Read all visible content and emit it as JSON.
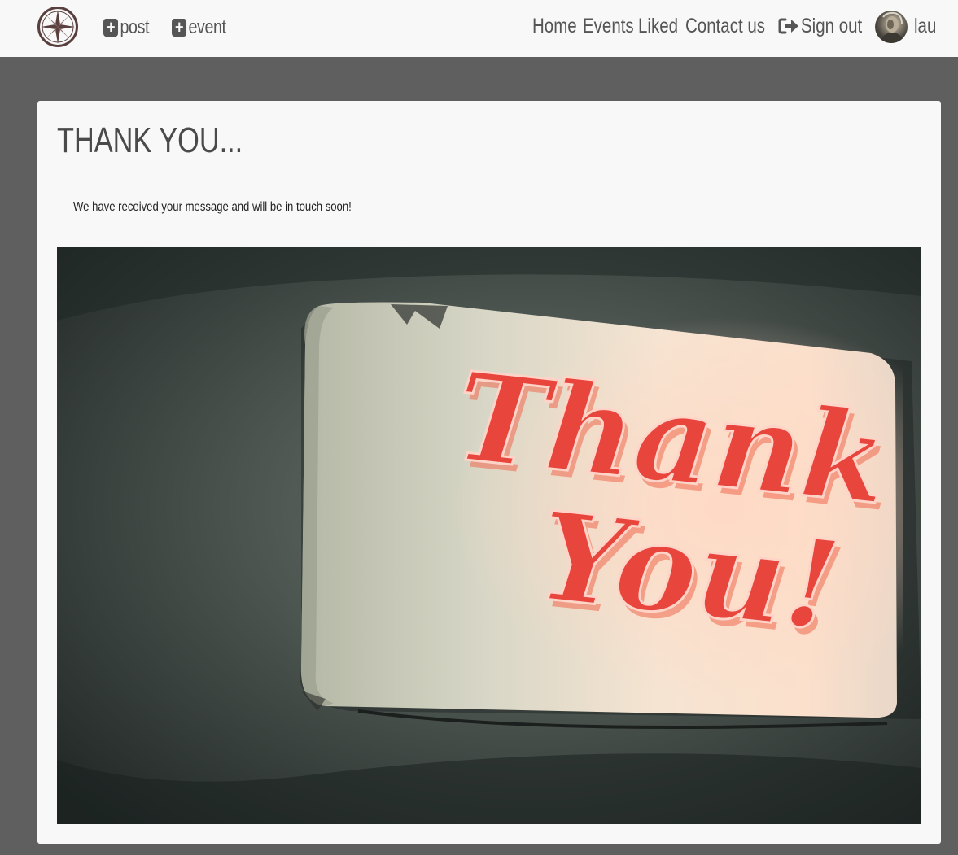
{
  "nav": {
    "logo_alt": "compass logo",
    "add_post_label": "post",
    "add_event_label": "event",
    "links": {
      "home": "Home",
      "events": "Events",
      "liked": "Liked",
      "contact": "Contact us",
      "signout": "Sign out",
      "profile": "lau"
    },
    "icons": {
      "add": "plus-square-icon",
      "signout": "sign-out-icon",
      "logo": "compass-icon"
    }
  },
  "main": {
    "title": "THANK YOU...",
    "message": "We have received your message and will be in touch soon!",
    "image_text": "Thank You!"
  },
  "colors": {
    "navbar_bg": "#f8f8f8",
    "page_bg": "#5f5f5f",
    "text": "#555555",
    "neon": "#e8453c"
  }
}
